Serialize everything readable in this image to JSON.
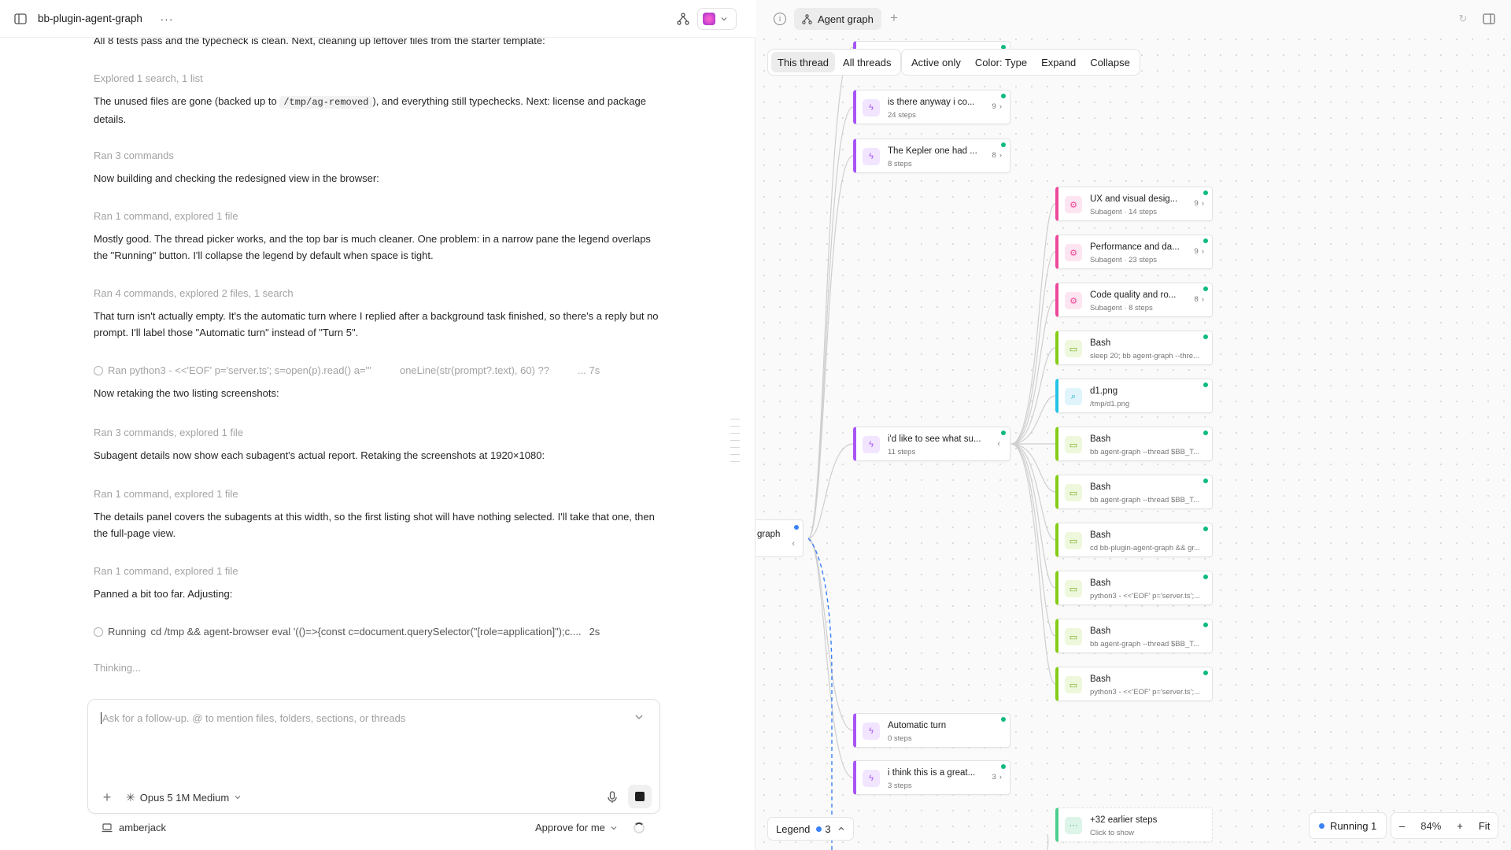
{
  "topbar": {
    "project_title": "bb-plugin-agent-graph",
    "more": "···"
  },
  "chat": {
    "messages": [
      {
        "kind": "text",
        "text": "All 8 tests pass and the typecheck is clean. Next, cleaning up leftover files from the starter template:"
      },
      {
        "kind": "meta",
        "text": "Explored 1 search, 1 list"
      },
      {
        "kind": "text_code",
        "before": "The unused files are gone (backed up to ",
        "code": "/tmp/ag-removed",
        "after": "), and everything still typechecks. Next: license and package details."
      },
      {
        "kind": "meta",
        "text": "Ran 3 commands"
      },
      {
        "kind": "text",
        "text": "Now building and checking the redesigned view in the browser:"
      },
      {
        "kind": "meta",
        "text": "Ran 1 command, explored 1 file"
      },
      {
        "kind": "text",
        "text": "Mostly good. The thread picker works, and the top bar is much cleaner. One problem: in a narrow pane the legend overlaps the \"Running\" button. I'll collapse the legend by default when space is tight."
      },
      {
        "kind": "meta",
        "text": "Ran 4 commands, explored 2 files, 1 search"
      },
      {
        "kind": "text",
        "text": "That turn isn't actually empty. It's the automatic turn where I replied after a background task finished, so there's a reply but no prompt. I'll label those \"Automatic turn\" instead of \"Turn 5\"."
      },
      {
        "kind": "cmd",
        "text": "Ran python3 - <<'EOF' p='server.ts'; s=open(p).read() a='''",
        "text2": "oneLine(str(prompt?.text), 60) ??",
        "time": "... 7s"
      },
      {
        "kind": "text",
        "text": "Now retaking the two listing screenshots:"
      },
      {
        "kind": "meta",
        "text": "Ran 3 commands, explored 1 file"
      },
      {
        "kind": "text",
        "text": "Subagent details now show each subagent's actual report. Retaking the screenshots at 1920×1080:"
      },
      {
        "kind": "meta",
        "text": "Ran 1 command, explored 1 file"
      },
      {
        "kind": "text",
        "text": "The details panel covers the subagents at this width, so the first listing shot will have nothing selected. I'll take that one, then the full-page view."
      },
      {
        "kind": "meta",
        "text": "Ran 1 command, explored 1 file"
      },
      {
        "kind": "text",
        "text": "Panned a bit too far. Adjusting:"
      },
      {
        "kind": "running",
        "label": "Running",
        "text": "cd /tmp && agent-browser eval '(()=>{const c=document.querySelector(\"[role=application]\");c....",
        "time": "2s"
      },
      {
        "kind": "meta",
        "text": "Thinking..."
      }
    ]
  },
  "composer": {
    "placeholder": "Ask for a follow-up. @ to mention files, folders, sections, or threads",
    "add": "+",
    "model": "Opus 5 1M Medium"
  },
  "footer": {
    "workspace": "amberjack",
    "approve": "Approve for me"
  },
  "graph": {
    "tab_label": "Agent graph",
    "tab_add": "+",
    "filters_a": [
      "This thread",
      "All threads"
    ],
    "filters_b": [
      "Active only",
      "Color: Type",
      "Expand",
      "Collapse"
    ],
    "root_label": "graph",
    "nodes": [
      {
        "color": "purple",
        "title": "is there anyway i co...",
        "sub": "24 steps",
        "count": "9"
      },
      {
        "color": "purple",
        "title": "The Kepler one had ...",
        "sub": "8 steps",
        "count": "8"
      },
      {
        "color": "purple",
        "title": "i'd like to see what su...",
        "sub": "11 steps",
        "count": ""
      },
      {
        "color": "purple",
        "title": "Automatic turn",
        "sub": "0 steps",
        "count": ""
      },
      {
        "color": "purple",
        "title": "i think this is a great...",
        "sub": "3 steps",
        "count": "3"
      },
      {
        "color": "pink",
        "title": "UX and visual desig...",
        "sub": "Subagent · 14 steps",
        "count": "9"
      },
      {
        "color": "pink",
        "title": "Performance and da...",
        "sub": "Subagent · 23 steps",
        "count": "9"
      },
      {
        "color": "pink",
        "title": "Code quality and ro...",
        "sub": "Subagent · 8 steps",
        "count": "8"
      },
      {
        "color": "green",
        "title": "Bash",
        "sub": "sleep 20; bb agent-graph --thre...",
        "count": ""
      },
      {
        "color": "cyan",
        "title": "d1.png",
        "sub": "/tmp/d1.png",
        "count": ""
      },
      {
        "color": "green",
        "title": "Bash",
        "sub": "bb agent-graph --thread $BB_T...",
        "count": ""
      },
      {
        "color": "green",
        "title": "Bash",
        "sub": "bb agent-graph --thread $BB_T...",
        "count": ""
      },
      {
        "color": "green",
        "title": "Bash",
        "sub": "cd bb-plugin-agent-graph && gr...",
        "count": ""
      },
      {
        "color": "green",
        "title": "Bash",
        "sub": "python3 - <<'EOF' p='server.ts';...",
        "count": ""
      },
      {
        "color": "green",
        "title": "Bash",
        "sub": "bb agent-graph --thread $BB_T...",
        "count": ""
      },
      {
        "color": "green",
        "title": "Bash",
        "sub": "python3 - <<'EOF' p='server.ts';...",
        "count": ""
      },
      {
        "color": "teal",
        "title": "+32 earlier steps",
        "sub": "Click to show",
        "count": ""
      }
    ],
    "legend_label": "Legend",
    "legend_count": "3",
    "running_label": "Running 1",
    "zoom_out": "–",
    "zoom_level": "84%",
    "zoom_in": "+",
    "fit": "Fit"
  }
}
